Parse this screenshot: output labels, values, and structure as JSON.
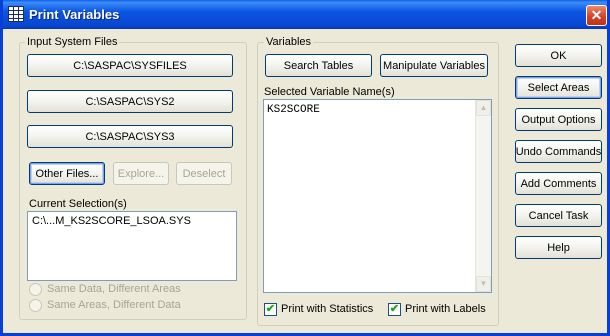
{
  "window": {
    "title": "Print Variables",
    "close_glyph": "✕"
  },
  "input_files": {
    "group_label": "Input System Files",
    "file_buttons": [
      "C:\\SASPAC\\SYSFILES",
      "C:\\SASPAC\\SYS2",
      "C:\\SASPAC\\SYS3"
    ],
    "other_files": "Other Files...",
    "explore": "Explore...",
    "deselect": "Deselect",
    "current_selection_label": "Current Selection(s)",
    "current_selection_items": [
      "C:\\...M_KS2SCORE_LSOA.SYS"
    ],
    "radio_same_data": "Same Data, Different Areas",
    "radio_same_areas": "Same Areas, Different Data"
  },
  "variables": {
    "group_label": "Variables",
    "search_tables": "Search Tables",
    "manipulate_variables": "Manipulate Variables",
    "selected_label": "Selected Variable Name(s)",
    "selected_items": [
      "KS2SCORE"
    ],
    "print_statistics": "Print with Statistics",
    "print_statistics_checked": true,
    "print_labels": "Print with Labels",
    "print_labels_checked": true
  },
  "actions": {
    "ok": "OK",
    "select_areas": "Select Areas",
    "output_options": "Output Options",
    "undo_commands": "Undo Commands",
    "add_comments": "Add Comments",
    "cancel_task": "Cancel Task",
    "help": "Help"
  },
  "icons": {
    "app": "table-grid-icon",
    "close": "close-icon",
    "scroll_up": "scroll-up-arrow-icon",
    "scroll_down": "scroll-down-arrow-icon"
  },
  "colors": {
    "titlebar": "#0b55e3",
    "dialog_bg": "#ece9d8",
    "button_border": "#003c74",
    "close_red": "#d5422a",
    "check_green": "#21a121"
  }
}
